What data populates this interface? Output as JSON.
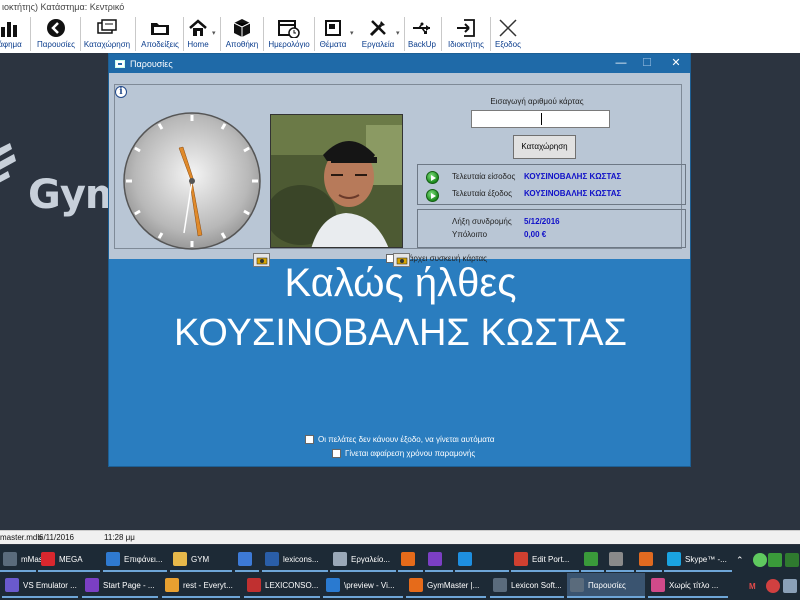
{
  "app": {
    "title": "ιοκτήτης) Κατάστημα: Κεντρικό"
  },
  "toolbar": {
    "items": [
      {
        "label": "άφημα",
        "icon": "chart-icon"
      },
      {
        "label": "Παρουσίες",
        "icon": "arrow-circle-icon"
      },
      {
        "label": "Καταχώρηση",
        "icon": "cards-icon"
      },
      {
        "label": "Αποδείξεις",
        "icon": "folder-icon"
      },
      {
        "label": "Home",
        "icon": "home-icon"
      },
      {
        "label": "Αποθήκη",
        "icon": "box-icon"
      },
      {
        "label": "Ημερολόγιο",
        "icon": "calendar-icon"
      },
      {
        "label": "Θέματα",
        "icon": "window-icon"
      },
      {
        "label": "Εργαλεία",
        "icon": "tools-icon"
      },
      {
        "label": "BackUp",
        "icon": "usb-icon"
      },
      {
        "label": "Ιδιοκτήτης",
        "icon": "exit-icon"
      },
      {
        "label": "Εξοδος",
        "icon": "close-icon"
      }
    ]
  },
  "background": {
    "logo_text": "GymM"
  },
  "dialog": {
    "title": "Παρουσίες",
    "minimize": "—",
    "maximize": "☐",
    "close": "✕",
    "info_icon": "i",
    "device_label": "Υπάρχει συσκευή κάρτας",
    "card_input_label": "Εισαγωγή αριθμού κάρτας",
    "card_input_value": "",
    "register_button": "Καταχώρηση",
    "last_entry_label": "Τελευταία είσοδος",
    "last_entry_value": "ΚΟΥΣΙΝΟΒΑΛΗΣ ΚΩΣΤΑΣ",
    "last_exit_label": "Τελευταία έξοδος",
    "last_exit_value": "ΚΟΥΣΙΝΟΒΑΛΗΣ ΚΩΣΤΑΣ",
    "subscription_label": "Λήξη συνδρομής",
    "subscription_value": "5/12/2016",
    "balance_label": "Υπόλοιπο",
    "balance_value": "0,00 €",
    "welcome_line1": "Καλώς ήλθες",
    "welcome_line2": "ΚΟΥΣΙΝΟΒΑΛΗΣ ΚΩΣΤΑΣ",
    "option1": "Οι πελάτες δεν κάνουν έξοδο, να γίνεται αυτόματα",
    "option2": "Γίνεται αφαίρεση χρόνου παραμονής"
  },
  "statusbar": {
    "db": "master.mdb",
    "date": "6/11/2016",
    "time": "11:28 μμ"
  },
  "taskbar": {
    "row1": [
      {
        "label": "mMas...",
        "color": "#5a6b7c"
      },
      {
        "label": "MEGA",
        "color": "#d9272e"
      },
      {
        "label": "Επιφάνει...",
        "color": "#2f7ad1"
      },
      {
        "label": "GYM",
        "color": "#e8b84a"
      },
      {
        "label": "",
        "color": "#3d7ad6"
      },
      {
        "label": "lexicons...",
        "color": "#2a5ea8"
      },
      {
        "label": "Εργαλείο...",
        "color": "#9aa8b8"
      },
      {
        "label": "",
        "color": "#e66b1a"
      },
      {
        "label": "",
        "color": "#7b3fc4"
      },
      {
        "label": "",
        "color": "#1e8fe0"
      },
      {
        "label": "Edit Port...",
        "color": "#d04030"
      },
      {
        "label": "",
        "color": "#3a9a3a"
      },
      {
        "label": "",
        "color": "#8a8a8a"
      },
      {
        "label": "",
        "color": "#e06a20"
      },
      {
        "label": "Skype™ -...",
        "color": "#1aa3e0"
      }
    ],
    "row2": [
      {
        "label": "VS Emulator ...",
        "color": "#6a5acd"
      },
      {
        "label": "Start Page - ...",
        "color": "#7b3fc4"
      },
      {
        "label": "rest - Everyt...",
        "color": "#e8a030"
      },
      {
        "label": "LEXICONSO...",
        "color": "#c03030"
      },
      {
        "label": "\\preview - Vi...",
        "color": "#2a7ad0"
      },
      {
        "label": "GymMaster |...",
        "color": "#e66b1a"
      },
      {
        "label": "Lexicon Soft...",
        "color": "#5a6b7c"
      },
      {
        "label": "Παρουσίες",
        "color": "#5a6b7c"
      },
      {
        "label": "Χωρίς τίτλο ...",
        "color": "#d04a8a"
      }
    ],
    "tray_letter": "M"
  }
}
